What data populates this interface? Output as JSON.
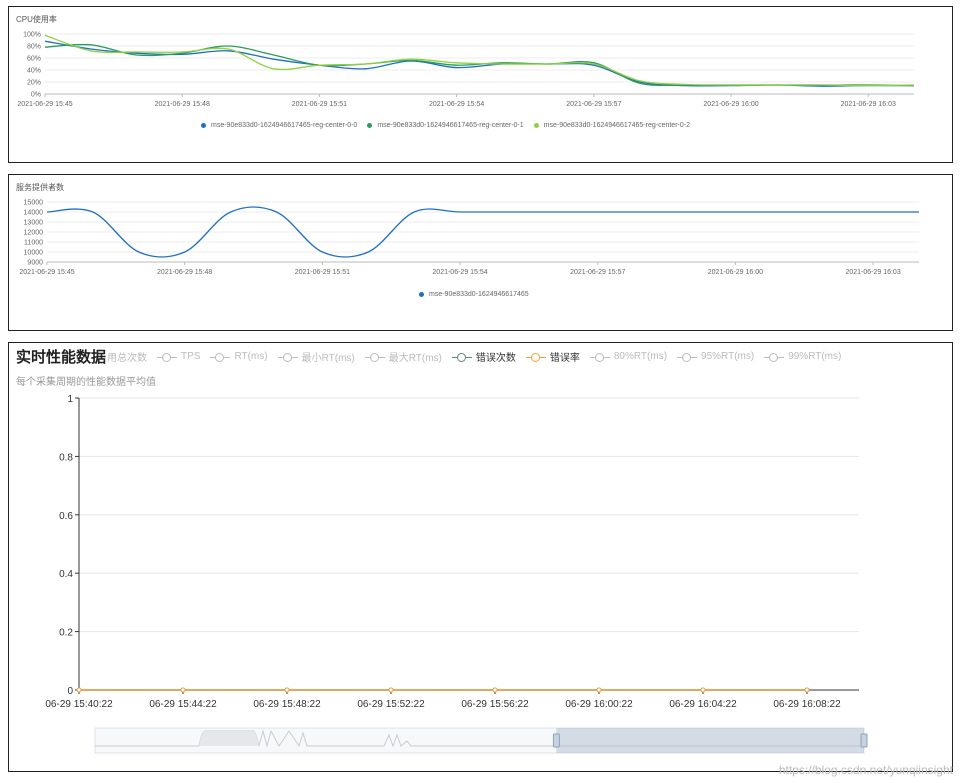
{
  "chart_data": [
    {
      "type": "line",
      "title": "CPU使用率",
      "x": [
        "2021-06-29 15:45",
        "2021-06-29 15:46",
        "2021-06-29 15:47",
        "2021-06-29 15:48",
        "2021-06-29 15:49",
        "2021-06-29 15:50",
        "2021-06-29 15:51",
        "2021-06-29 15:52",
        "2021-06-29 15:53",
        "2021-06-29 15:54",
        "2021-06-29 15:55",
        "2021-06-29 15:56",
        "2021-06-29 15:57",
        "2021-06-29 15:58",
        "2021-06-29 15:59",
        "2021-06-29 16:00",
        "2021-06-29 16:01",
        "2021-06-29 16:02",
        "2021-06-29 16:03",
        "2021-06-29 16:04"
      ],
      "x_tick_labels": [
        "2021-06-29 15:45",
        "2021-06-29 15:48",
        "2021-06-29 15:51",
        "2021-06-29 15:54",
        "2021-06-29 15:57",
        "2021-06-29 16:00",
        "2021-06-29 16:03"
      ],
      "y_tick_labels": [
        "100%",
        "80%",
        "60%",
        "40%",
        "20%",
        "0%"
      ],
      "ylim": [
        0,
        100
      ],
      "grid": true,
      "legend_position": "bottom",
      "series": [
        {
          "name": "mse-90e833d0-1624946617465-reg-center-0-0",
          "color": "#1f6fc5",
          "values": [
            88,
            75,
            68,
            66,
            72,
            58,
            48,
            42,
            55,
            44,
            50,
            50,
            48,
            20,
            14,
            14,
            15,
            13,
            14,
            14
          ]
        },
        {
          "name": "mse-90e833d0-1624946617465-reg-center-0-1",
          "color": "#2a9d5c",
          "values": [
            78,
            82,
            65,
            68,
            80,
            65,
            48,
            50,
            56,
            48,
            52,
            50,
            52,
            18,
            15,
            15,
            15,
            15,
            15,
            14
          ]
        },
        {
          "name": "mse-90e833d0-1624946617465-reg-center-0-2",
          "color": "#8fd13f",
          "values": [
            98,
            72,
            70,
            70,
            75,
            42,
            48,
            50,
            58,
            52,
            50,
            50,
            50,
            22,
            16,
            15,
            15,
            15,
            14,
            15
          ]
        }
      ]
    },
    {
      "type": "line",
      "title": "服务提供者数",
      "x": [
        "2021-06-29 15:45",
        "2021-06-29 15:46",
        "2021-06-29 15:47",
        "2021-06-29 15:48",
        "2021-06-29 15:49",
        "2021-06-29 15:50",
        "2021-06-29 15:51",
        "2021-06-29 15:52",
        "2021-06-29 15:53",
        "2021-06-29 15:54",
        "2021-06-29 15:55",
        "2021-06-29 15:56",
        "2021-06-29 15:57",
        "2021-06-29 15:58",
        "2021-06-29 15:59",
        "2021-06-29 16:00",
        "2021-06-29 16:01",
        "2021-06-29 16:02",
        "2021-06-29 16:03",
        "2021-06-29 16:04"
      ],
      "x_tick_labels": [
        "2021-06-29 15:45",
        "2021-06-29 15:48",
        "2021-06-29 15:51",
        "2021-06-29 15:54",
        "2021-06-29 15:57",
        "2021-06-29 16:00",
        "2021-06-29 16:03"
      ],
      "y_tick_labels": [
        "15000",
        "14000",
        "13000",
        "12000",
        "11000",
        "10000",
        "9000"
      ],
      "ylim": [
        9000,
        15000
      ],
      "grid": true,
      "legend_position": "bottom",
      "series": [
        {
          "name": "mse-90e833d0-1624946617465",
          "color": "#1f6fc5",
          "values": [
            14000,
            14000,
            10000,
            10000,
            14000,
            14000,
            10000,
            10000,
            14000,
            14000,
            14000,
            14000,
            14000,
            14000,
            14000,
            14000,
            14000,
            14000,
            14000,
            14000
          ]
        }
      ]
    },
    {
      "type": "line",
      "title": "实时性能数据",
      "subtitle": "每个采集周期的性能数据平均值",
      "x_tick_labels": [
        "06-29 15:40:22",
        "06-29 15:44:22",
        "06-29 15:48:22",
        "06-29 15:52:22",
        "06-29 15:56:22",
        "06-29 16:00:22",
        "06-29 16:04:22",
        "06-29 16:08:22"
      ],
      "y_tick_labels": [
        "1",
        "0.8",
        "0.6",
        "0.4",
        "0.2",
        "0"
      ],
      "ylim": [
        0,
        1
      ],
      "grid": true,
      "legend_position": "top",
      "legend": [
        {
          "label": "用总次数",
          "active": false,
          "color": "#bbbbbb"
        },
        {
          "label": "TPS",
          "active": false,
          "color": "#bbbbbb"
        },
        {
          "label": "RT(ms)",
          "active": false,
          "color": "#bbbbbb"
        },
        {
          "label": "最小RT(ms)",
          "active": false,
          "color": "#bbbbbb"
        },
        {
          "label": "最大RT(ms)",
          "active": false,
          "color": "#bbbbbb"
        },
        {
          "label": "错误次数",
          "active": true,
          "color": "#5a8a78"
        },
        {
          "label": "错误率",
          "active": true,
          "color": "#f0a23c"
        },
        {
          "label": "80%RT(ms)",
          "active": false,
          "color": "#bbbbbb"
        },
        {
          "label": "95%RT(ms)",
          "active": false,
          "color": "#bbbbbb"
        },
        {
          "label": "99%RT(ms)",
          "active": false,
          "color": "#bbbbbb"
        }
      ],
      "series": [
        {
          "name": "错误次数",
          "color": "#5a8a78",
          "values": [
            0,
            0,
            0,
            0,
            0,
            0,
            0,
            0
          ]
        },
        {
          "name": "错误率",
          "color": "#f0a23c",
          "values": [
            0,
            0,
            0,
            0,
            0,
            0,
            0,
            0
          ]
        }
      ],
      "zoom_range": [
        0.6,
        1.0
      ]
    }
  ],
  "watermark": "https://blog.csdn.net/yunqiinsight"
}
